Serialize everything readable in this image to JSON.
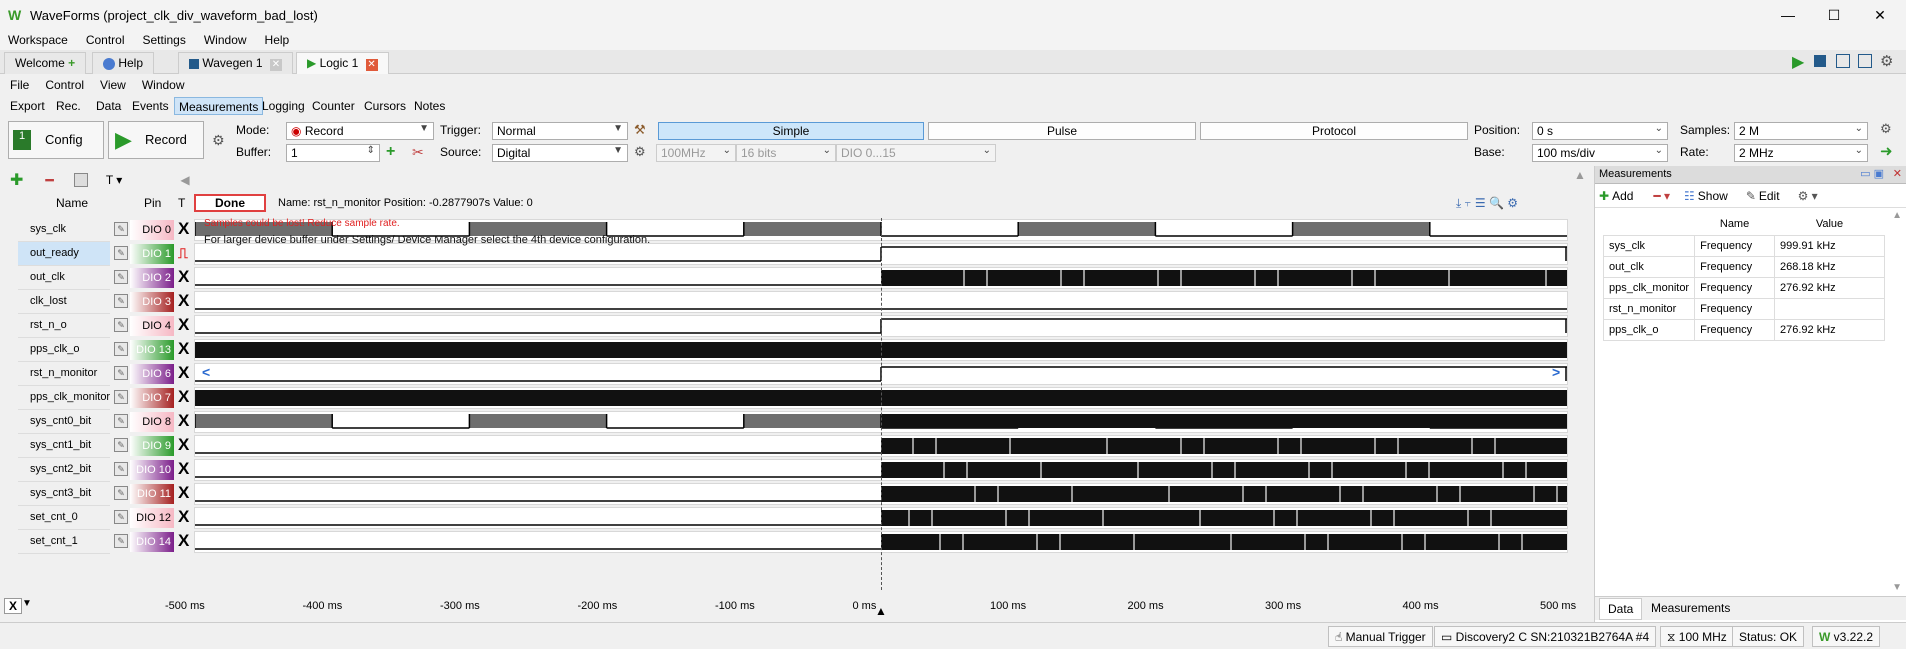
{
  "window": {
    "title": "WaveForms (project_clk_div_waveform_bad_lost)",
    "controls": [
      "—",
      "☐",
      "✕"
    ]
  },
  "menubar": [
    "Workspace",
    "Control",
    "Settings",
    "Window",
    "Help"
  ],
  "tabs": [
    {
      "label": "Welcome",
      "close": "+"
    },
    {
      "label": "Help",
      "close": ""
    },
    {
      "label": "Wavegen 1",
      "close": "✕"
    },
    {
      "label": "Logic 1",
      "close": "✕"
    }
  ],
  "submenu": [
    "File",
    "Control",
    "View",
    "Window"
  ],
  "subtabs": [
    "Export",
    "Rec.",
    "Data",
    "Events",
    "Measurements",
    "Logging",
    "Counter",
    "Cursors",
    "Notes"
  ],
  "toolbar": {
    "config_label": "Config",
    "record_label": "Record",
    "mode_label": "Mode:",
    "mode_value": "Record",
    "buffer_label": "Buffer:",
    "buffer_value": "1",
    "trigger_label": "Trigger:",
    "trigger_value": "Normal",
    "source_label": "Source:",
    "source_value": "Digital",
    "rate_opt": "100MHz",
    "bits_opt": "16 bits",
    "dio_opt": "DIO 0...15",
    "modes": [
      "Simple",
      "Pulse",
      "Protocol"
    ],
    "position_label": "Position:",
    "position_value": "0 s",
    "base_label": "Base:",
    "base_value": "100 ms/div",
    "samples_label": "Samples:",
    "samples_value": "2 M",
    "rate_label": "Rate:",
    "rate_value": "2 MHz"
  },
  "channels_header": {
    "name": "Name",
    "pin": "Pin",
    "t": "T"
  },
  "status_bar": {
    "done": "Done",
    "info": "Name: rst_n_monitor  Position: -0.2877907s  Value: 0",
    "warning1": "Samples could be lost! Reduce sample rate.",
    "warning2": "For larger device buffer under Settings/ Device Manager select the 4th device configuration."
  },
  "channels": [
    {
      "name": "sys_clk",
      "pin": "DIO 0",
      "color": "#f6b8c4"
    },
    {
      "name": "out_ready",
      "pin": "DIO 1",
      "color": "#2a9a2a"
    },
    {
      "name": "out_clk",
      "pin": "DIO 2",
      "color": "#7b1e8a"
    },
    {
      "name": "clk_lost",
      "pin": "DIO 3",
      "color": "#a52020"
    },
    {
      "name": "rst_n_o",
      "pin": "DIO 4",
      "color": "#f6b8c4"
    },
    {
      "name": "pps_clk_o",
      "pin": "DIO 13",
      "color": "#2a9a2a"
    },
    {
      "name": "rst_n_monitor",
      "pin": "DIO 6",
      "color": "#7b1e8a"
    },
    {
      "name": "pps_clk_monitor",
      "pin": "DIO 7",
      "color": "#a52020"
    },
    {
      "name": "sys_cnt0_bit",
      "pin": "DIO 8",
      "color": "#f6b8c4"
    },
    {
      "name": "sys_cnt1_bit",
      "pin": "DIO 9",
      "color": "#2a9a2a"
    },
    {
      "name": "sys_cnt2_bit",
      "pin": "DIO 10",
      "color": "#7b1e8a"
    },
    {
      "name": "sys_cnt3_bit",
      "pin": "DIO 11",
      "color": "#a52020"
    },
    {
      "name": "set_cnt_0",
      "pin": "DIO 12",
      "color": "#f6b8c4"
    },
    {
      "name": "set_cnt_1",
      "pin": "DIO 14",
      "color": "#7b1e8a"
    }
  ],
  "axis_ticks": [
    "-500 ms",
    "-400 ms",
    "-300 ms",
    "-200 ms",
    "-100 ms",
    "0 ms",
    "100 ms",
    "200 ms",
    "300 ms",
    "400 ms",
    "500 ms"
  ],
  "axis_zoom": "X",
  "measurements": {
    "title": "Measurements",
    "add_label": "Add",
    "show_label": "Show",
    "edit_label": "Edit",
    "col_name": "Name",
    "col_value": "Value",
    "rows": [
      {
        "ch": "sys_clk",
        "name": "Frequency",
        "value": "999.91 kHz"
      },
      {
        "ch": "out_clk",
        "name": "Frequency",
        "value": "268.18 kHz"
      },
      {
        "ch": "pps_clk_monitor",
        "name": "Frequency",
        "value": "276.92 kHz"
      },
      {
        "ch": "rst_n_monitor",
        "name": "Frequency",
        "value": ""
      },
      {
        "ch": "pps_clk_o",
        "name": "Frequency",
        "value": "276.92 kHz"
      }
    ],
    "bottom_tabs": [
      "Data",
      "Measurements"
    ]
  },
  "statusbar": {
    "manual_trigger": "Manual Trigger",
    "device": "Discovery2 C SN:210321B2764A #4",
    "freq": "100 MHz",
    "status": "Status: OK",
    "version": "v3.22.2"
  }
}
